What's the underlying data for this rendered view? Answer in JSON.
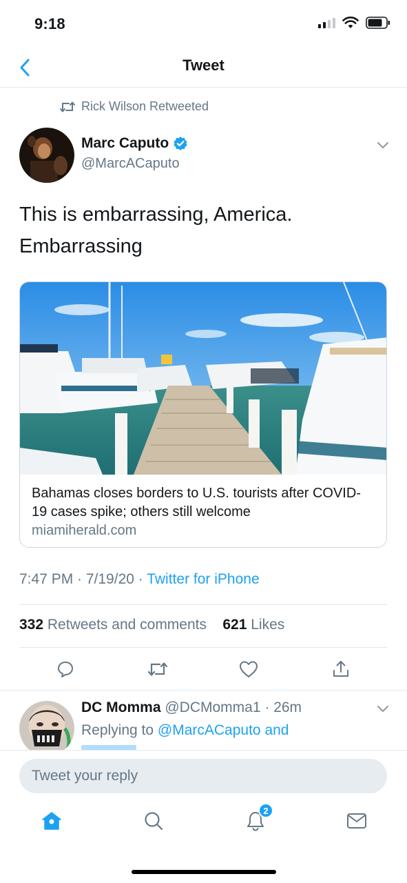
{
  "status_bar": {
    "time": "9:18"
  },
  "nav": {
    "title": "Tweet"
  },
  "retweet_context": {
    "text": "Rick Wilson Retweeted"
  },
  "tweet": {
    "author_name": "Marc Caputo",
    "author_handle": "@MarcACaputo",
    "text_line1": "This is embarrassing, America.",
    "text_line2": "Embarrassing",
    "card": {
      "title": "Bahamas closes borders to U.S. tourists after COVID-19 cases spike; others still welcome",
      "domain": "miamiherald.com"
    },
    "time": "7:47 PM · 7/19/20 · ",
    "source": "Twitter for iPhone",
    "retweets_count": "332",
    "retweets_label": "Retweets and comments",
    "likes_count": "621",
    "likes_label": "Likes"
  },
  "reply": {
    "name": "DC Momma",
    "handle_time": "@DCMomma1 · 26m",
    "replying_prefix": "Replying to ",
    "replying_targets": "@MarcACaputo and"
  },
  "compose": {
    "placeholder": "Tweet your reply"
  },
  "tabbar": {
    "notifications_badge": "2"
  },
  "colors": {
    "accent": "#1da1f2",
    "secondary_text": "#657786",
    "border": "#e1e8ed"
  }
}
